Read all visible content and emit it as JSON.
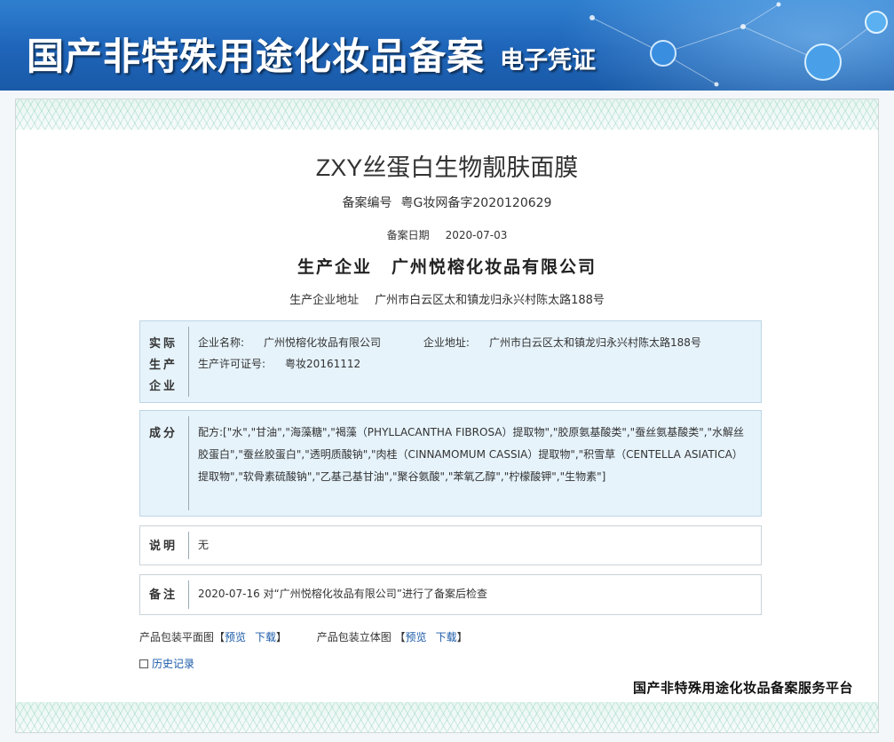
{
  "banner": {
    "title": "国产非特殊用途化妆品备案",
    "subtitle": "电子凭证"
  },
  "product": {
    "name": "ZXY丝蛋白生物靓肤面膜"
  },
  "record": {
    "number_label": "备案编号",
    "number": "粤G妆网备字2020120629",
    "date_label": "备案日期",
    "date": "2020-07-03",
    "producer_label": "生产企业",
    "producer": "广州悦榕化妆品有限公司",
    "address_label": "生产企业地址",
    "address": "广州市白云区太和镇龙归永兴村陈太路188号"
  },
  "actual_producer": {
    "heading": "实际生产企业",
    "name_label": "企业名称:",
    "name": "广州悦榕化妆品有限公司",
    "address_label": "企业地址:",
    "address": "广州市白云区太和镇龙归永兴村陈太路188号",
    "license_label": "生产许可证号:",
    "license": "粤妆20161112"
  },
  "ingredients": {
    "heading": "成分",
    "text": "配方:[\"水\",\"甘油\",\"海藻糖\",\"褐藻（PHYLLACANTHA FIBROSA）提取物\",\"胶原氨基酸类\",\"蚕丝氨基酸类\",\"水解丝胶蛋白\",\"蚕丝胶蛋白\",\"透明质酸钠\",\"肉桂（CINNAMOMUM CASSIA）提取物\",\"积雪草（CENTELLA ASIATICA）提取物\",\"软骨素硫酸钠\",\"乙基己基甘油\",\"聚谷氨酸\",\"苯氧乙醇\",\"柠檬酸钾\",\"生物素\"]"
  },
  "description": {
    "heading": "说明",
    "text": "无"
  },
  "note": {
    "heading": "备注",
    "text": "2020-07-16 对“广州悦榕化妆品有限公司”进行了备案后检查"
  },
  "packaging": {
    "flat_label": "产品包装平面图【",
    "solid_label": "产品包装立体图 【",
    "preview": "预览",
    "download": "下载",
    "close_bracket": "】"
  },
  "history": {
    "label": "历史记录"
  },
  "footer": {
    "platform": "国产非特殊用途化妆品备案服务平台"
  },
  "colors": {
    "banner_blue": "#1e64b8",
    "box_blue": "#e6f3fb",
    "link": "#1a5aa8"
  }
}
